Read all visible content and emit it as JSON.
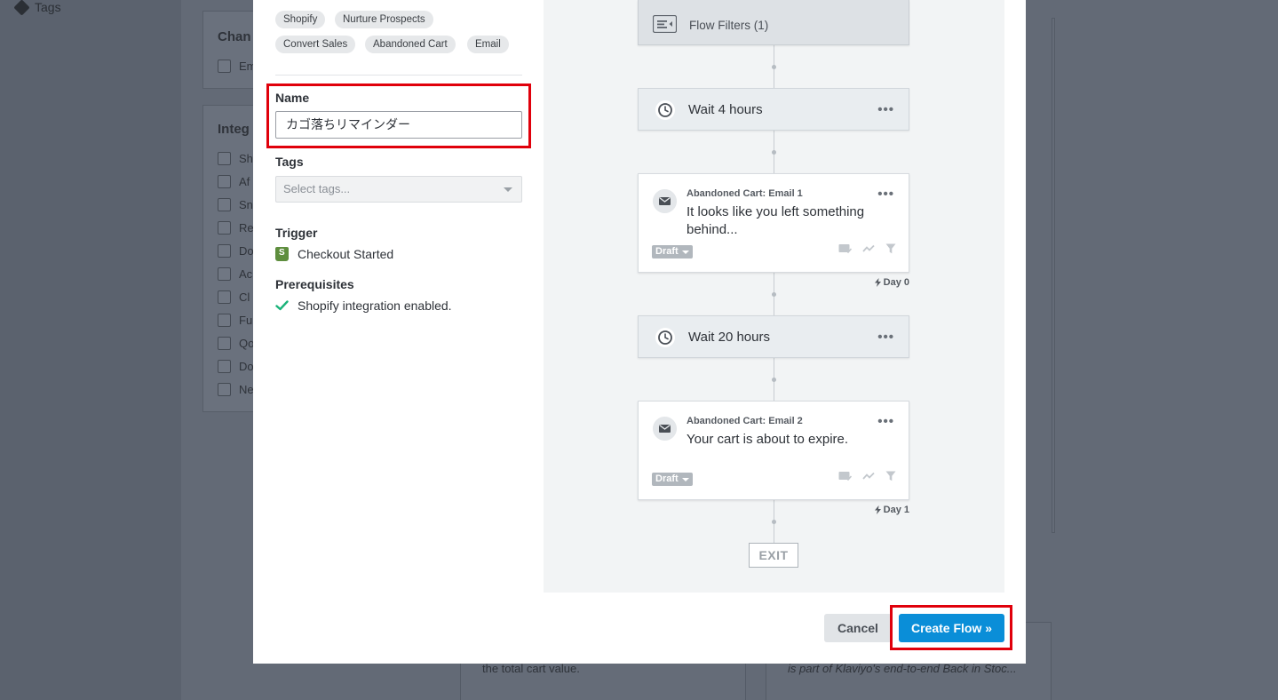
{
  "background": {
    "sidebar_tags": "Tags",
    "panel1_title": "Chan",
    "panel1_items": [
      "Em"
    ],
    "panel2_title": "Integ",
    "panel2_items": [
      "Sh",
      "Af",
      "Sn",
      "Re",
      "Do",
      "Ac",
      "Cl",
      "Fu",
      "Qo",
      "Do",
      "Ne"
    ],
    "card1_text": "the total cart value.",
    "card2_text": "is part of Klaviyo's end-to-end Back in Stoc..."
  },
  "modal": {
    "chips": [
      "Shopify",
      "Nurture Prospects",
      "Convert Sales",
      "Abandoned Cart",
      "Email"
    ],
    "name_label": "Name",
    "name_value": "カゴ落ちリマインダー",
    "tags_label": "Tags",
    "tags_placeholder": "Select tags...",
    "trigger_label": "Trigger",
    "trigger_value": "Checkout Started",
    "prereq_label": "Prerequisites",
    "prereq_value": "Shopify integration enabled.",
    "cancel_label": "Cancel",
    "create_label": "Create Flow »"
  },
  "flow": {
    "filters_label": "Flow Filters (1)",
    "wait1": "Wait 4 hours",
    "email1": {
      "name": "Abandoned Cart: Email 1",
      "subject": "It looks like you left something behind...",
      "status": "Draft",
      "day": "Day 0"
    },
    "wait2": "Wait 20 hours",
    "email2": {
      "name": "Abandoned Cart: Email 2",
      "subject": "Your cart is about to expire.",
      "status": "Draft",
      "day": "Day 1"
    },
    "exit_label": "EXIT",
    "more_glyph": "•••"
  },
  "colors": {
    "primary": "#0a8ed8",
    "highlight": "#e0000b",
    "shopify_green": "#5e8e3e",
    "check_green": "#1bb37a"
  }
}
